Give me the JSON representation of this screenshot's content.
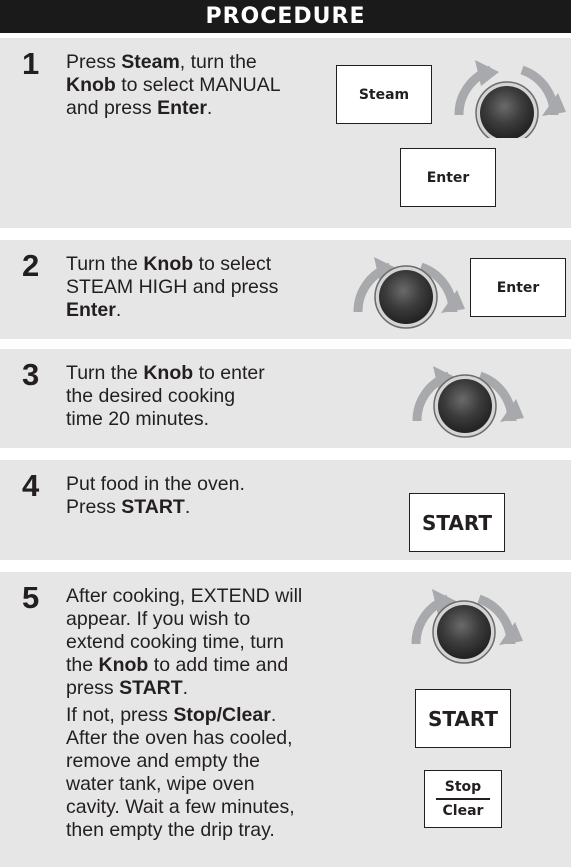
{
  "header": {
    "title": "PROCEDURE"
  },
  "steps": [
    {
      "num": "1",
      "t1": "Press ",
      "b1": "Steam",
      "t2": ", turn the",
      "b2": "Knob",
      "t3": " to select MANUAL",
      "t4": "and press ",
      "b3": "Enter",
      "t5": ".",
      "btn_steam": "Steam",
      "btn_enter": "Enter",
      "knob_icon": "rotary-knob-icon"
    },
    {
      "num": "2",
      "t1": "Turn the ",
      "b1": "Knob",
      "t2": " to select",
      "t3": "STEAM HIGH and press",
      "b2": "Enter",
      "t4": ".",
      "btn_enter": "Enter",
      "knob_icon": "rotary-knob-icon"
    },
    {
      "num": "3",
      "t1": "Turn the ",
      "b1": "Knob",
      "t2": " to enter",
      "t3": "the desired cooking",
      "t4": "time 20 minutes.",
      "knob_icon": "rotary-knob-icon"
    },
    {
      "num": "4",
      "t1": "Put food in the oven.",
      "t2": "Press ",
      "b1": "START",
      "t3": ".",
      "btn_start": "START"
    },
    {
      "num": "5",
      "l1": "After cooking, EXTEND will",
      "l2": "appear. If you wish to",
      "l3": "extend cooking time, turn",
      "l4a": "the ",
      "l4b": "Knob",
      "l4c": " to add time and",
      "l5a": "press ",
      "l5b": "START",
      "l5c": ".",
      "l6a": "If not, press ",
      "l6b": "Stop/Clear",
      "l6c": ".",
      "l7": "After the oven has cooled,",
      "l8": "remove and empty the",
      "l9": "water tank, wipe oven",
      "l10": "cavity. Wait a few minutes,",
      "l11": "then empty the drip tray.",
      "btn_start": "START",
      "btn_stop_top": "Stop",
      "btn_stop_bottom": "Clear",
      "knob_icon": "rotary-knob-icon"
    }
  ],
  "colors": {
    "panel": "#e6e6e6",
    "header": "#1a1a1a",
    "arrow": "#a7a9ac",
    "knob": "#3a3a3a"
  }
}
